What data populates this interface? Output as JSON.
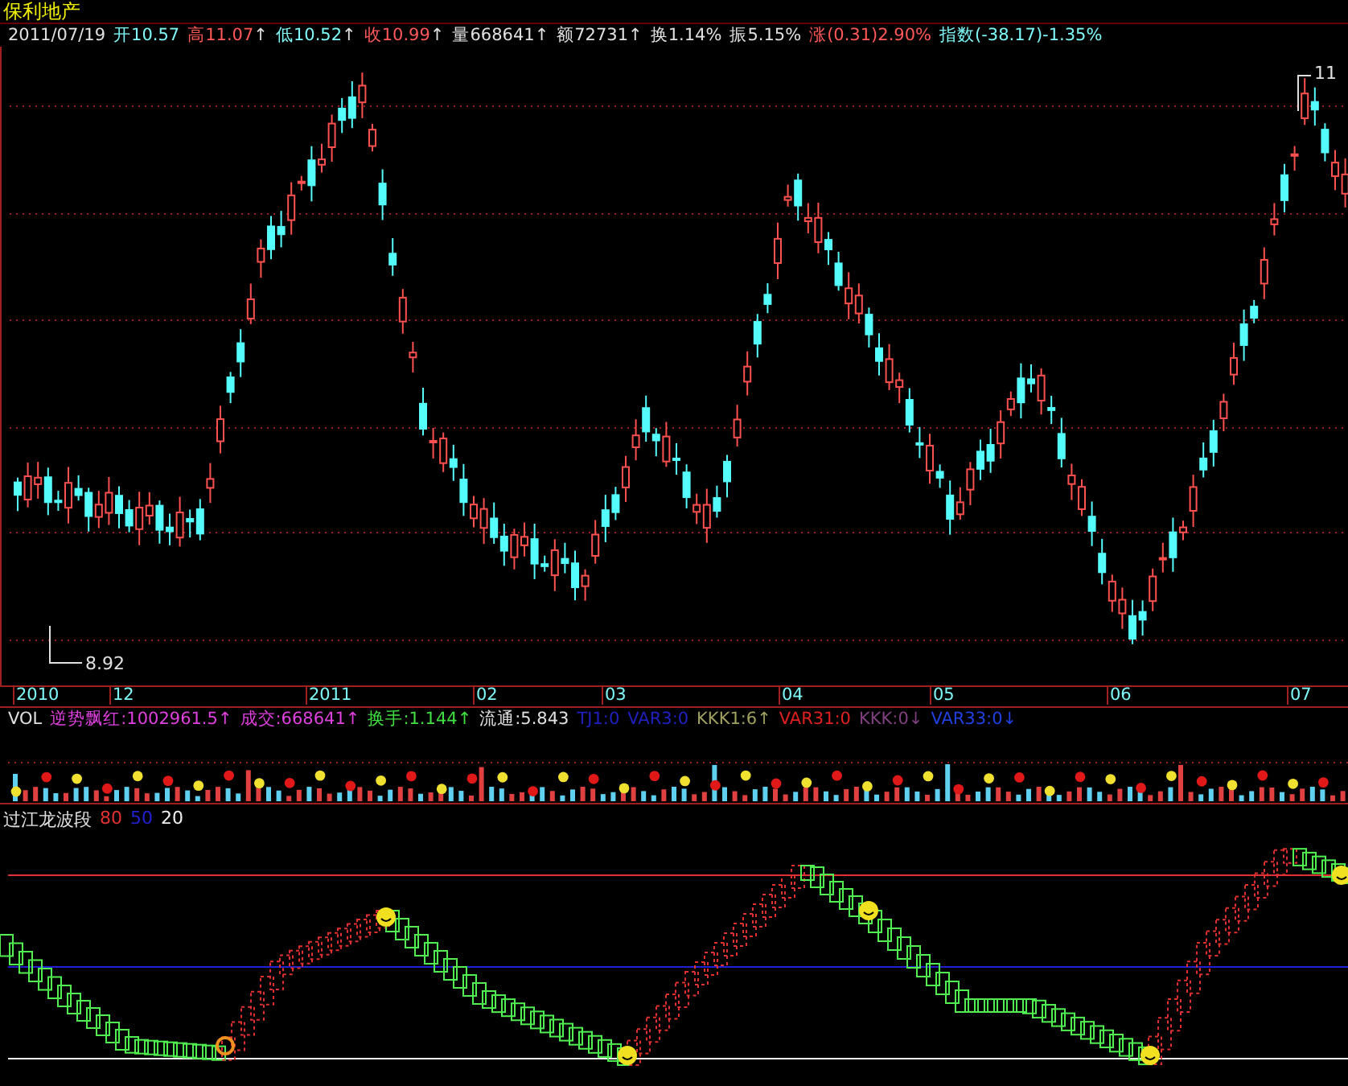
{
  "title": "保利地产",
  "quote": {
    "items": [
      {
        "text": "2011/07/19",
        "color": "#e0e0e0"
      },
      {
        "text": "开10.57",
        "color": "#7ff8f8"
      },
      {
        "text": "高11.07",
        "arrow": "↑",
        "color": "#ff5858"
      },
      {
        "text": "低10.52",
        "arrow": "↑",
        "color": "#7ff8f8"
      },
      {
        "text": "收10.99",
        "arrow": "↑",
        "color": "#ff5858"
      },
      {
        "text": "量668641",
        "arrow": "↑",
        "color": "#e0e0e0"
      },
      {
        "text": "额72731",
        "arrow": "↑",
        "color": "#e0e0e0"
      },
      {
        "text": "换1.14%",
        "color": "#e0e0e0"
      },
      {
        "text": "振5.15%",
        "color": "#e0e0e0"
      },
      {
        "text": "涨(0.31)2.90%",
        "color": "#ff5858"
      },
      {
        "text": "指数(-38.17)-1.35%",
        "color": "#7ff8f8"
      }
    ]
  },
  "price_chart": {
    "high_marker": "11",
    "low_marker": "8.92",
    "time_axis": [
      "2010",
      "12",
      "2011",
      "02",
      "03",
      "04",
      "05",
      "06",
      "07"
    ]
  },
  "volume_panel": {
    "items": [
      {
        "text": "VOL",
        "color": "#e0e0e0"
      },
      {
        "text": "逆势飘红:1002961.5",
        "arrow": "↑",
        "color": "#e040e0"
      },
      {
        "text": "成交:668641",
        "arrow": "↑",
        "color": "#e040e0"
      },
      {
        "text": "换手:1.144",
        "arrow": "↑",
        "color": "#40e040"
      },
      {
        "text": "流通:5.843",
        "color": "#e0e0e0"
      },
      {
        "text": "TJ1:0",
        "color": "#2020c0"
      },
      {
        "text": "VAR3:0",
        "color": "#2020c0"
      },
      {
        "text": "KKK1:6",
        "arrow": "↑",
        "color": "#a0a060"
      },
      {
        "text": "VAR31:0",
        "color": "#e02020"
      },
      {
        "text": "KKK:0",
        "arrow": "↓",
        "color": "#804080"
      },
      {
        "text": "VAR33:0",
        "arrow": "↓",
        "color": "#2040e0"
      }
    ]
  },
  "wave_panel": {
    "name": "过江龙波段",
    "levels": [
      {
        "text": "80",
        "color": "#e03030"
      },
      {
        "text": "50",
        "color": "#2020d0"
      },
      {
        "text": "20",
        "color": "#f0f0f0"
      }
    ]
  }
}
